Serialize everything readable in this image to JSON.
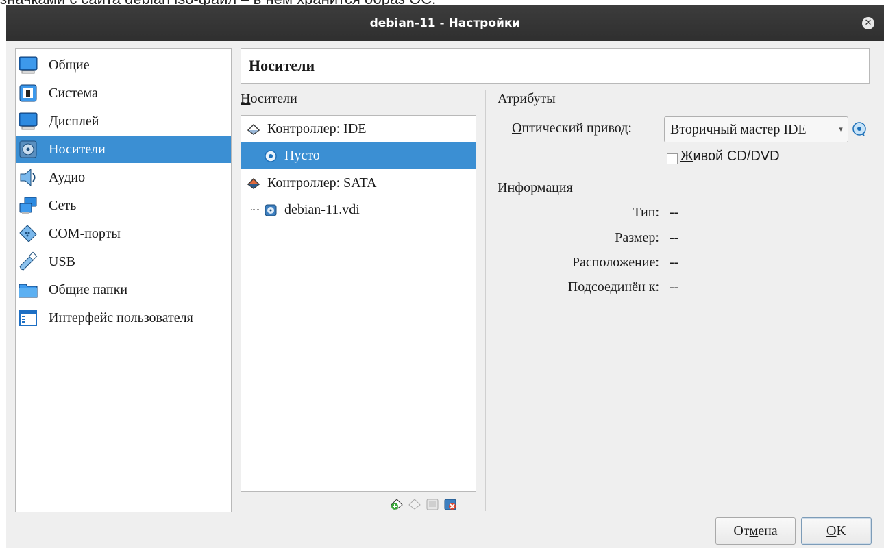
{
  "background_text": "значками с сайта debian iso-файл – в нем хранится образ ОС.",
  "window": {
    "title": "debian-11 - Настройки",
    "close_glyph": "✕"
  },
  "sidebar": {
    "items": [
      {
        "label": "Общие",
        "icon": "general-monitor-icon"
      },
      {
        "label": "Система",
        "icon": "system-chip-icon"
      },
      {
        "label": "Дисплей",
        "icon": "display-monitor-icon"
      },
      {
        "label": "Носители",
        "icon": "storage-disk-icon",
        "selected": true
      },
      {
        "label": "Аудио",
        "icon": "audio-speaker-icon"
      },
      {
        "label": "Сеть",
        "icon": "network-icon"
      },
      {
        "label": "COM-порты",
        "icon": "serial-port-icon"
      },
      {
        "label": "USB",
        "icon": "usb-icon"
      },
      {
        "label": "Общие папки",
        "icon": "shared-folder-icon"
      },
      {
        "label": "Интерфейс пользователя",
        "icon": "user-interface-icon"
      }
    ]
  },
  "page_header": "Носители",
  "storage": {
    "group_label": "Носители",
    "tree": [
      {
        "label": "Контроллер: IDE",
        "type": "controller"
      },
      {
        "label": "Пусто",
        "type": "optical",
        "selected": true
      },
      {
        "label": "Контроллер: SATA",
        "type": "controller"
      },
      {
        "label": "debian-11.vdi",
        "type": "disk"
      }
    ]
  },
  "attributes": {
    "group_label": "Атрибуты",
    "optical_drive_label": "Оптический привод:",
    "optical_drive_value": "Вторичный мастер IDE",
    "live_cd_label_u": "Ж",
    "live_cd_label_rest": "ивой CD/DVD",
    "live_cd_checked": false
  },
  "information": {
    "group_label": "Информация",
    "rows": [
      {
        "key": "Тип:",
        "value": "--"
      },
      {
        "key": "Размер:",
        "value": "--"
      },
      {
        "key": "Расположение:",
        "value": "--"
      },
      {
        "key": "Подсоединён к:",
        "value": "--"
      }
    ]
  },
  "buttons": {
    "cancel_pre": "От",
    "cancel_u": "м",
    "cancel_post": "ена",
    "ok_u": "O",
    "ok_post": "K"
  },
  "colors": {
    "selection": "#3b8fd3",
    "titlebar": "#333333",
    "dialog_bg": "#efefef"
  }
}
